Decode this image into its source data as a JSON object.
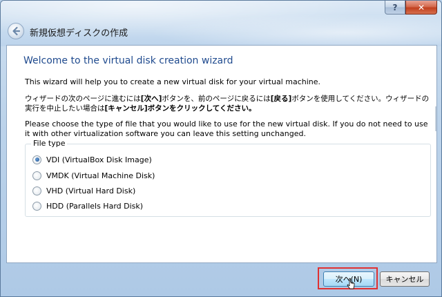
{
  "window": {
    "title": "新規仮想ディスクの作成",
    "help_label": "?",
    "close_label": "✕"
  },
  "wizard": {
    "heading": "Welcome to the virtual disk creation wizard",
    "intro": "This wizard will help you to create a new virtual disk for your virtual machine.",
    "instructions_parts": [
      "ウィザードの次のページに進むには",
      "[次へ]",
      "ボタンを、前のページに戻るには",
      "[戻る]",
      "ボタンを使用してください。ウィザードの実行を中止したい場合は",
      "[キャンセル]",
      "ボタンをクリックしてください。"
    ],
    "choose_text": "Please choose the type of file that you would like to use for the new virtual disk. If you do not need to use it with other virtualization software you can leave this setting unchanged."
  },
  "file_type": {
    "group_label": "File type",
    "options": [
      {
        "label": "VDI (VirtualBox Disk Image)",
        "checked": true
      },
      {
        "label": "VMDK (Virtual Machine Disk)",
        "checked": false
      },
      {
        "label": "VHD (Virtual Hard Disk)",
        "checked": false
      },
      {
        "label": "HDD (Parallels Hard Disk)",
        "checked": false
      }
    ]
  },
  "buttons": {
    "next_label": "次へ(N)",
    "cancel_label": "キャンセル"
  },
  "colors": {
    "heading": "#1f4a8e",
    "highlight": "#e03030"
  }
}
